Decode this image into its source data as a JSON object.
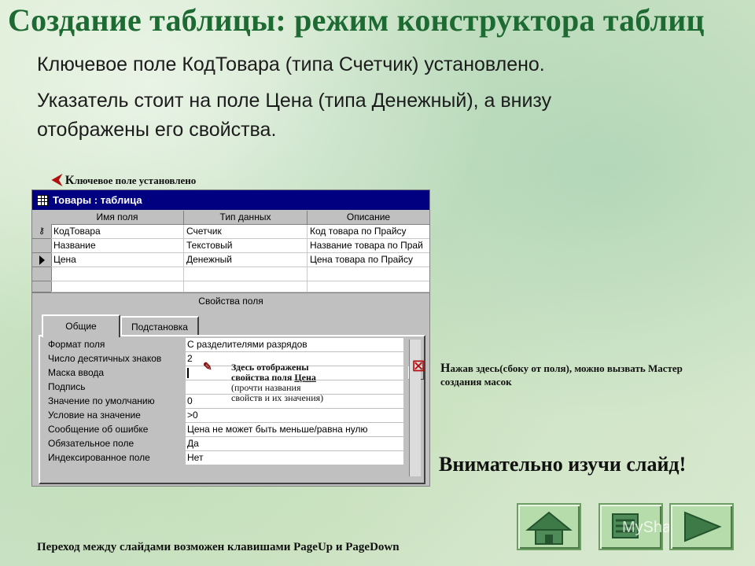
{
  "slide": {
    "title": "Создание таблицы: режим конструктора таблиц",
    "line1": "Ключевое поле КодТовара (типа Счетчик) установлено.",
    "line2a": "Указатель стоит на поле Цена (типа Денежный), а внизу",
    "line2b": "отображены его свойства.",
    "key_note_cap": "К",
    "key_note_rest": "лючевое поле установлено",
    "wizard_note_cap": "Н",
    "wizard_note_line1_rest": "ажав здесь(сбоку от поля), можно вызвать Мастер",
    "wizard_note_line2": "создания масок",
    "props_note_line1": "Здесь отображены",
    "props_note_line2a": "свойства поля ",
    "props_note_line2b": "Цена",
    "props_note_line3": "(прочти названия",
    "props_note_line4": "свойств и их значения)",
    "attention": "Внимательно изучи слайд!",
    "footer": "Переход между слайдами возможен клавишами PageUp и PageDown",
    "colors": {
      "title": "#1e6a33",
      "window_title_bg": "#000080",
      "note_arrow": "#b21010"
    }
  },
  "window": {
    "title": "Товары : таблица",
    "columns": [
      "Имя поля",
      "Тип данных",
      "Описание"
    ],
    "rows": [
      {
        "name": "КодТовара",
        "type": "Счетчик",
        "desc": "Код товара по Прайсу",
        "marker": "key-icon"
      },
      {
        "name": "Название",
        "type": "Текстовый",
        "desc": "Название товара по Прай",
        "marker": ""
      },
      {
        "name": "Цена",
        "type": "Денежный",
        "desc": "Цена товара по Прайсу",
        "marker": "pointer-icon"
      },
      {
        "name": "",
        "type": "",
        "desc": "",
        "marker": ""
      },
      {
        "name": "",
        "type": "",
        "desc": "",
        "marker": ""
      }
    ],
    "props_header": "Свойства поля",
    "tabs": [
      "Общие",
      "Подстановка"
    ],
    "active_tab": "Общие",
    "properties": [
      {
        "label": "Формат поля",
        "value": "С разделителями разрядов"
      },
      {
        "label": "Число десятичных знаков",
        "value": "2"
      },
      {
        "label": "Маска ввода",
        "value": ""
      },
      {
        "label": "Подпись",
        "value": ""
      },
      {
        "label": "Значение по умолчанию",
        "value": "0"
      },
      {
        "label": "Условие на значение",
        "value": ">0"
      },
      {
        "label": "Сообщение об ошибке",
        "value": "Цена не может быть меньше/равна нулю"
      },
      {
        "label": "Обязательное поле",
        "value": "Да"
      },
      {
        "label": "Индексированное поле",
        "value": "Нет"
      }
    ],
    "builder_button": "..."
  },
  "nav": {
    "buttons": [
      "home-icon",
      "list-icon",
      "next-icon"
    ],
    "watermark": "MyShared"
  }
}
